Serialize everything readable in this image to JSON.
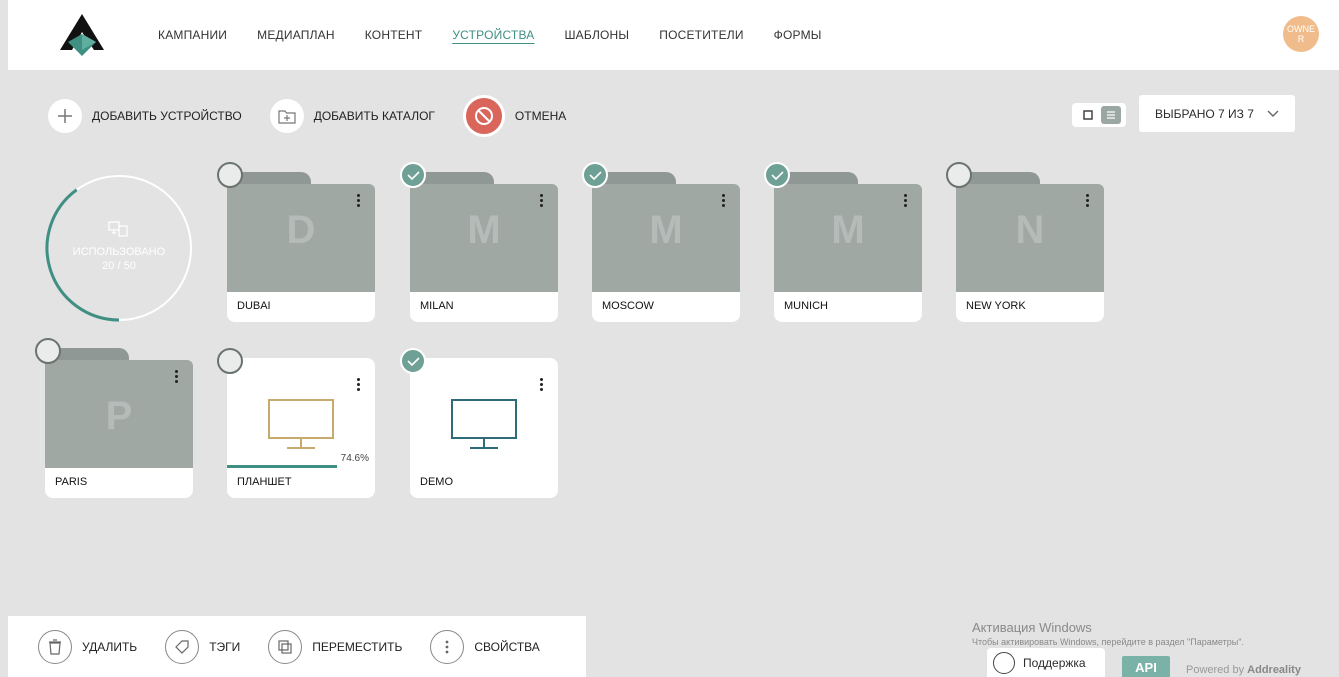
{
  "nav": {
    "items": [
      "КАМПАНИИ",
      "МЕДИАПЛАН",
      "КОНТЕНТ",
      "УСТРОЙСТВА",
      "ШАБЛОНЫ",
      "ПОСЕТИТЕЛИ",
      "ФОРМЫ"
    ],
    "active": "УСТРОЙСТВА",
    "avatar": "OWNER"
  },
  "toolbar": {
    "add_device": "ДОБАВИТЬ УСТРОЙСТВО",
    "add_catalog": "ДОБАВИТЬ КАТАЛОГ",
    "cancel": "ОТМЕНА",
    "selected": "ВЫБРАНО 7 ИЗ 7"
  },
  "usage": {
    "label": "ИСПОЛЬЗОВАНО",
    "value": "20 / 50",
    "used": 20,
    "total": 50
  },
  "folders": [
    {
      "name": "DUBAI",
      "letter": "D",
      "checked": false
    },
    {
      "name": "MILAN",
      "letter": "M",
      "checked": true
    },
    {
      "name": "MOSCOW",
      "letter": "M",
      "checked": true
    },
    {
      "name": "MUNICH",
      "letter": "M",
      "checked": true
    },
    {
      "name": "NEW YORK",
      "letter": "N",
      "checked": false
    },
    {
      "name": "PARIS",
      "letter": "P",
      "checked": false
    }
  ],
  "devices": [
    {
      "name": "ПЛАНШЕТ",
      "checked": false,
      "progress": "74.6%",
      "progress_value": 0.746,
      "color": "#c8aa6e"
    },
    {
      "name": "DEMO",
      "checked": true,
      "color": "#2f6b78"
    }
  ],
  "bottom": {
    "delete": "УДАЛИТЬ",
    "tags": "ТЭГИ",
    "move": "ПЕРЕМЕСТИТЬ",
    "props": "СВОЙСТВА"
  },
  "footer": {
    "win_title": "Активация Windows",
    "win_sub": "Чтобы активировать Windows, перейдите в раздел \"Параметры\".",
    "support": "Поддержка",
    "api": "API",
    "powered_prefix": "Powered by",
    "powered_brand": "Addreality"
  },
  "colors": {
    "accent": "#3f8f83",
    "cancel": "#d9655b",
    "check": "#6ea096",
    "folder": "#a0a8a4"
  }
}
